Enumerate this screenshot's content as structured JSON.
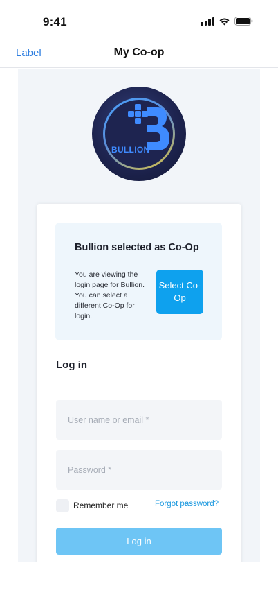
{
  "status_bar": {
    "time": "9:41",
    "icons": [
      "signal-icon",
      "wifi-icon",
      "battery-icon"
    ]
  },
  "nav": {
    "label": "Label",
    "title": "My Co-op"
  },
  "logo": {
    "text": "BULLION",
    "colors": {
      "brand": "#3f8bff",
      "ring_gold": "#e0c33c",
      "background": "#1e2450"
    }
  },
  "coop": {
    "title": "Bullion selected as Co-Op",
    "description": "You are viewing the login page for Bullion. You can select a different Co-Op for login.",
    "select_button": "Select Co-Op"
  },
  "login": {
    "heading": "Log in",
    "username_placeholder": "User name or email *",
    "password_placeholder": "Password *",
    "remember_me": "Remember me",
    "forgot_password": "Forgot password?",
    "submit": "Log in"
  },
  "colors": {
    "accent": "#0ea1ee",
    "link": "#1696de",
    "login_button": "#6ec5f5",
    "nav_label": "#2f7fe0"
  }
}
